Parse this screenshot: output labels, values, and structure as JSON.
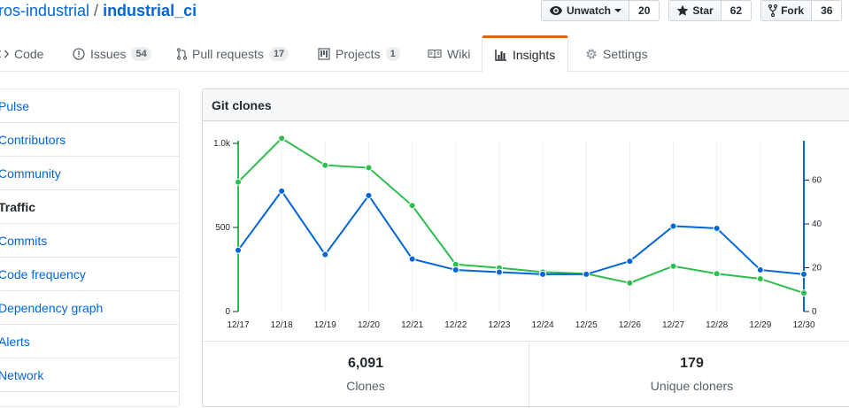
{
  "repo": {
    "owner": "ros-industrial",
    "separator": "/",
    "name": "industrial_ci"
  },
  "actions": {
    "watch": {
      "label": "Unwatch",
      "count": "20",
      "icon": "eye-icon"
    },
    "star": {
      "label": "Star",
      "count": "62",
      "icon": "star-icon"
    },
    "fork": {
      "label": "Fork",
      "count": "36",
      "icon": "fork-icon"
    }
  },
  "tabs": [
    {
      "label": "Code",
      "icon": "code-icon"
    },
    {
      "label": "Issues",
      "count": "54",
      "icon": "issue-icon"
    },
    {
      "label": "Pull requests",
      "count": "17",
      "icon": "pull-request-icon"
    },
    {
      "label": "Projects",
      "count": "1",
      "icon": "project-icon"
    },
    {
      "label": "Wiki",
      "icon": "book-icon"
    },
    {
      "label": "Insights",
      "icon": "graph-icon",
      "selected": true
    },
    {
      "label": "Settings",
      "icon": "gear-icon"
    }
  ],
  "sidebar": {
    "items": [
      {
        "label": "Pulse"
      },
      {
        "label": "Contributors"
      },
      {
        "label": "Community"
      },
      {
        "label": "Traffic",
        "active": true
      },
      {
        "label": "Commits"
      },
      {
        "label": "Code frequency"
      },
      {
        "label": "Dependency graph"
      },
      {
        "label": "Alerts"
      },
      {
        "label": "Network"
      }
    ]
  },
  "panel": {
    "title": "Git clones"
  },
  "colors": {
    "clones": "#2cbe4e",
    "unique": "#0366d6",
    "accent": "#e36209",
    "link": "#0366d6"
  },
  "chart_data": {
    "type": "line",
    "x": [
      "12/17",
      "12/18",
      "12/19",
      "12/20",
      "12/21",
      "12/22",
      "12/23",
      "12/24",
      "12/25",
      "12/26",
      "12/27",
      "12/28",
      "12/29",
      "12/30"
    ],
    "left_axis": {
      "ticks": [
        "0",
        "500",
        "1.0k"
      ],
      "range": [
        0,
        1000
      ]
    },
    "right_axis": {
      "ticks": [
        "0",
        "20",
        "40",
        "60"
      ],
      "range": [
        0,
        80
      ]
    },
    "series": [
      {
        "axis": "left",
        "values": [
          770,
          1030,
          870,
          855,
          630,
          280,
          260,
          235,
          225,
          170,
          270,
          225,
          195,
          110
        ]
      },
      {
        "axis": "right",
        "values": [
          28,
          55,
          26,
          53,
          24,
          19,
          18,
          17,
          17,
          23,
          39,
          38,
          19,
          17
        ]
      }
    ]
  },
  "stats": [
    {
      "value": "6,091",
      "label": "Clones"
    },
    {
      "value": "179",
      "label": "Unique cloners"
    }
  ]
}
